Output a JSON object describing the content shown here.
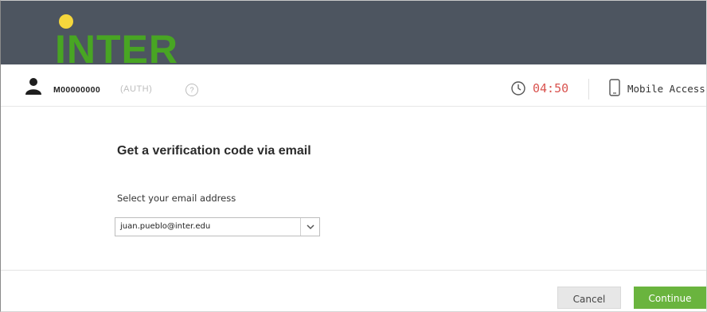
{
  "header": {
    "logo_text": "INTER",
    "colors": {
      "bar": "#4d5560",
      "logo_green": "#48a523",
      "logo_dot": "#f5d73c"
    }
  },
  "userbar": {
    "username": "M00000000",
    "auth_label": "(AUTH)",
    "help_icon": "?",
    "timer": "04:50",
    "timer_color": "#d9534f",
    "mobile_access_label": "Mobile Access"
  },
  "form": {
    "title": "Get a verification code via email",
    "select_label": "Select your email address",
    "selected_email": "juan.pueblo@inter.edu"
  },
  "actions": {
    "cancel_label": "Cancel",
    "continue_label": "Continue",
    "continue_color": "#6ab43e"
  }
}
